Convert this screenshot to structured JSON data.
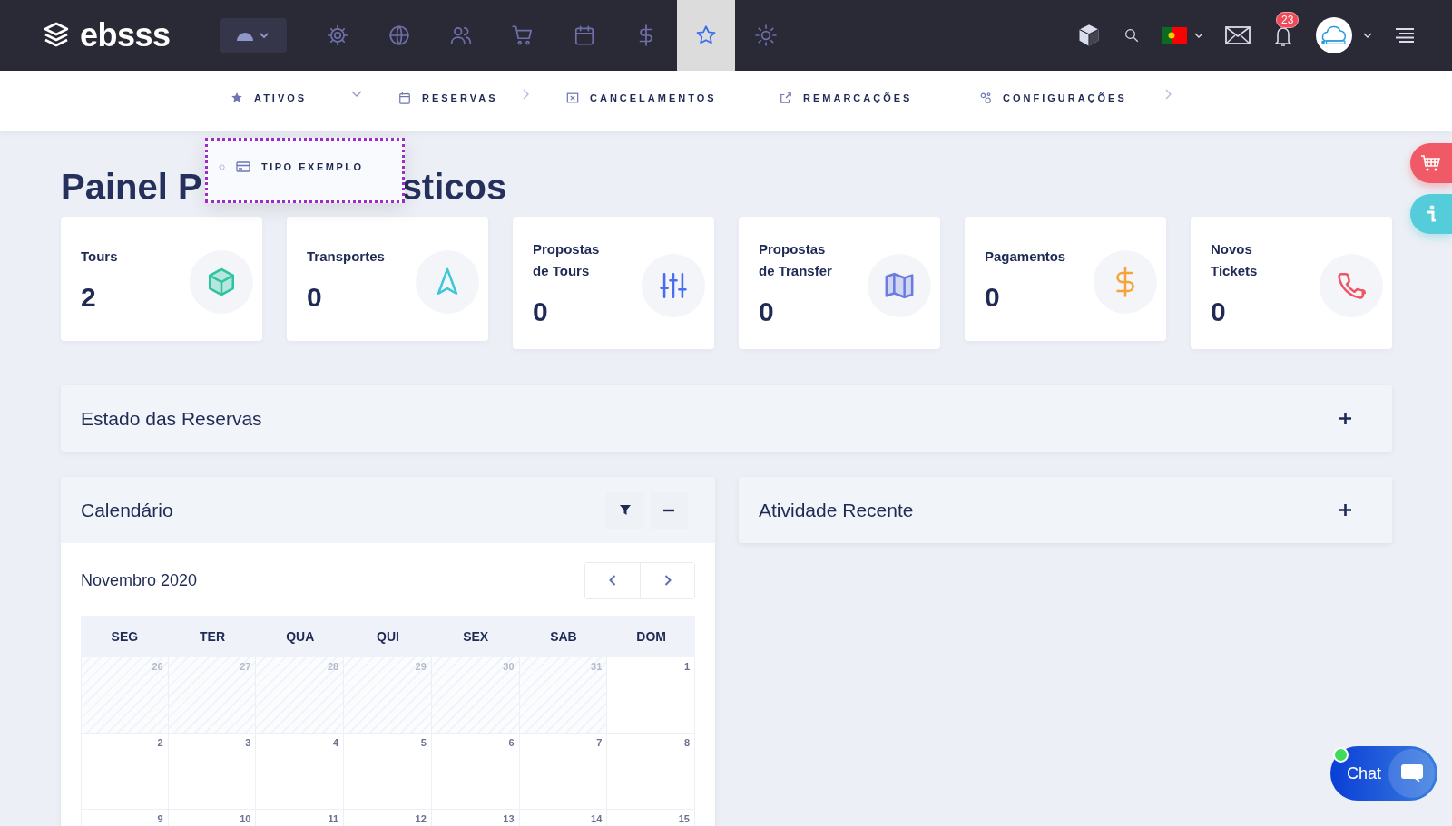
{
  "header": {
    "logo": "ebsss",
    "nav_icons": [
      {
        "selected": false
      },
      {
        "selected": false
      },
      {
        "selected": false
      },
      {
        "selected": false
      },
      {
        "selected": false
      },
      {
        "selected": false
      },
      {
        "selected": true
      },
      {
        "selected": false
      }
    ],
    "notification_count": "23"
  },
  "subnav": [
    {
      "label": "ATIVOS",
      "expanded": true
    },
    {
      "label": "RESERVAS",
      "expanded": false
    },
    {
      "label": "CANCELAMENTOS"
    },
    {
      "label": "REMARCAÇÕES"
    },
    {
      "label": "CONFIGURAÇÕES",
      "expanded": false
    }
  ],
  "dropdown": {
    "items": [
      "TIPO EXEMPLO"
    ]
  },
  "title_parts": [
    "Painel P",
    "sticos"
  ],
  "cards": [
    {
      "label": [
        "Tours"
      ],
      "value": "2"
    },
    {
      "label": [
        "Transportes"
      ],
      "value": "0"
    },
    {
      "label": [
        "Propostas",
        "de Tours"
      ],
      "value": "0"
    },
    {
      "label": [
        "Propostas",
        "de Transfer"
      ],
      "value": "0"
    },
    {
      "label": [
        "Pagamentos"
      ],
      "value": "0"
    },
    {
      "label": [
        "Novos",
        "Tickets"
      ],
      "value": "0"
    }
  ],
  "reservations_panel": {
    "title": "Estado das Reservas"
  },
  "calendar_panel": {
    "title": "Calendário",
    "month": "Novembro 2020",
    "weekdays": [
      "SEG",
      "TER",
      "QUA",
      "QUI",
      "SEX",
      "SAB",
      "DOM"
    ],
    "weeks": [
      [
        {
          "day": "26",
          "muted": true
        },
        {
          "day": "27",
          "muted": true
        },
        {
          "day": "28",
          "muted": true
        },
        {
          "day": "29",
          "muted": true
        },
        {
          "day": "30",
          "muted": true
        },
        {
          "day": "31",
          "muted": true
        },
        {
          "day": "1",
          "muted": false
        }
      ],
      [
        {
          "day": "2",
          "muted": false
        },
        {
          "day": "3",
          "muted": false
        },
        {
          "day": "4",
          "muted": false
        },
        {
          "day": "5",
          "muted": false
        },
        {
          "day": "6",
          "muted": false
        },
        {
          "day": "7",
          "muted": false
        },
        {
          "day": "8",
          "muted": false
        }
      ],
      [
        {
          "day": "9",
          "muted": false
        },
        {
          "day": "10",
          "muted": false
        },
        {
          "day": "11",
          "muted": false
        },
        {
          "day": "12",
          "muted": false
        },
        {
          "day": "13",
          "muted": false
        },
        {
          "day": "14",
          "muted": false
        },
        {
          "day": "15",
          "muted": false
        }
      ]
    ]
  },
  "activity_panel": {
    "title": "Atividade Recente"
  },
  "chat": {
    "label": "Chat",
    "online": true
  }
}
